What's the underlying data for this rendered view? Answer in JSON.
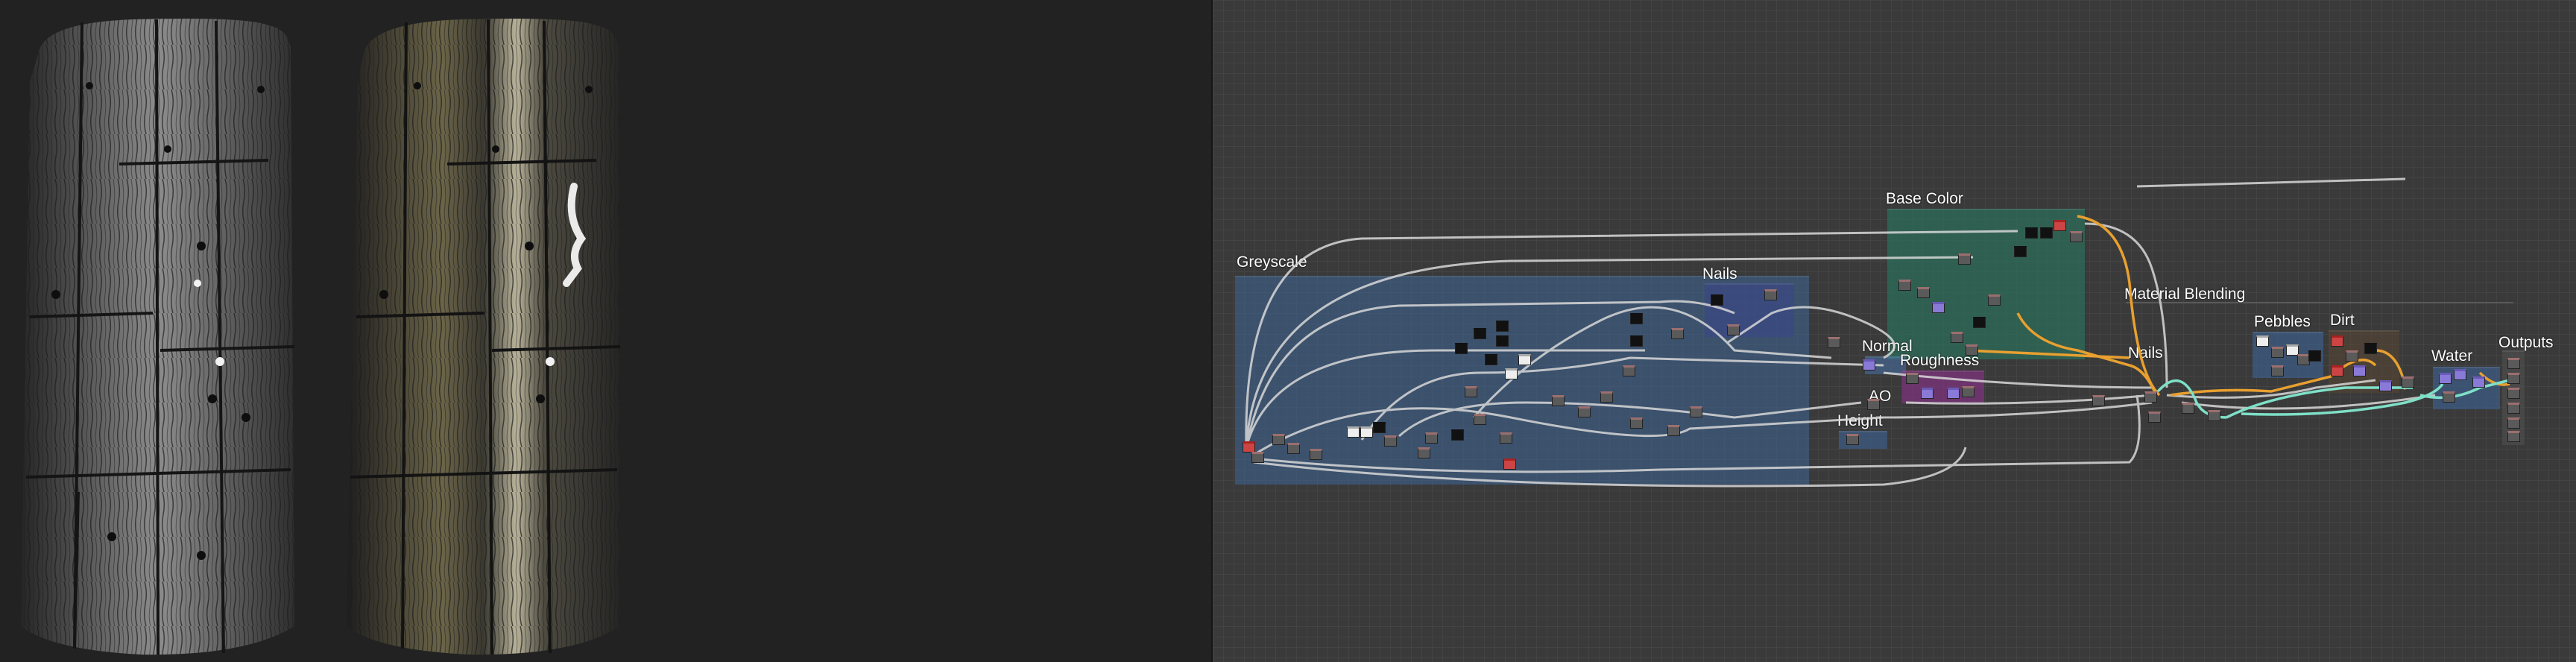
{
  "viewport": {
    "left_cylinder": "cylinder-preview-dry-wood",
    "right_cylinder": "cylinder-preview-wet-wood"
  },
  "graph": {
    "frames": {
      "greyscale": "Greyscale",
      "nails_inner": "Nails",
      "base_color": "Base Color",
      "material_blending": "Material Blending",
      "normal": "Normal",
      "roughness": "Roughness",
      "ao": "AO",
      "height": "Height",
      "nails_outer": "Nails",
      "pebbles": "Pebbles",
      "dirt": "Dirt",
      "water": "Water",
      "outputs": "Outputs"
    },
    "colors": {
      "blue_frame": "#3c5a78",
      "teal_frame": "#2f6e5a",
      "purple_frame": "#7a3a7a",
      "orange_wire": "#e8a030",
      "cyan_wire": "#7fe0c8",
      "white_wire": "#d8d8d8"
    }
  }
}
